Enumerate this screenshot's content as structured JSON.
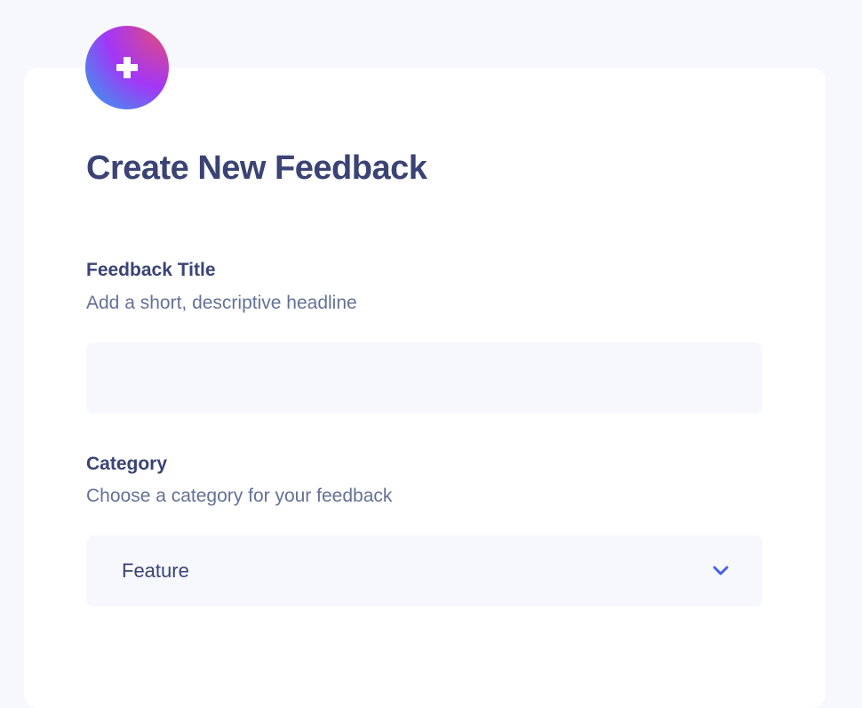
{
  "form": {
    "title": "Create New Feedback",
    "badge_icon": "plus-icon",
    "colors": {
      "heading": "#3A4374",
      "hint": "#647196",
      "field_background": "#F7F8FD",
      "accent": "#4661E6"
    }
  },
  "fields": {
    "feedback_title": {
      "label": "Feedback Title",
      "hint": "Add a short, descriptive headline",
      "value": ""
    },
    "category": {
      "label": "Category",
      "hint": "Choose a category for your feedback",
      "selected": "Feature",
      "icon": "chevron-down-icon"
    }
  }
}
